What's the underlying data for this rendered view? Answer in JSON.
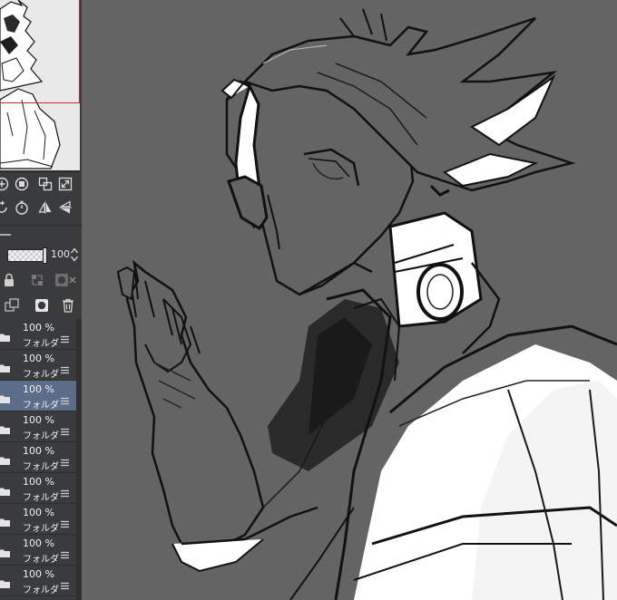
{
  "colors": {
    "panel_bg": "#3a3b3d",
    "canvas_bg": "#646464",
    "selected_layer": "#5c6d8a",
    "nav_frame": "#c4262e"
  },
  "tools": {
    "row1": [
      "plus-circle-icon",
      "stop-circle-icon",
      "transform-icon",
      "expand-icon"
    ],
    "row2": [
      "rotate-icon",
      "timer-icon",
      "flip-horizontal-icon",
      "flip-vertical-icon"
    ]
  },
  "layer_palette": {
    "opacity_value": "100",
    "icons_row1": [
      "lock-icon",
      "reference-icon",
      "clip-icon"
    ],
    "icons_row2": [
      "copy-icon",
      "mask-icon",
      "trash-icon"
    ]
  },
  "layers": [
    {
      "opacity": "100 %",
      "name": "フォルダ",
      "selected": false
    },
    {
      "opacity": "100 %",
      "name": "フォルダ",
      "selected": false
    },
    {
      "opacity": "100 %",
      "name": "フォルダ",
      "selected": true
    },
    {
      "opacity": "100 %",
      "name": "フォルダ",
      "selected": false
    },
    {
      "opacity": "100 %",
      "name": "フォルダ",
      "selected": false
    },
    {
      "opacity": "100 %",
      "name": "フォルダ",
      "selected": false
    },
    {
      "opacity": "100 %",
      "name": "フォルダ",
      "selected": false
    },
    {
      "opacity": "100 %",
      "name": "フォルダ",
      "selected": false
    },
    {
      "opacity": "100 %",
      "name": "フォルダ",
      "selected": false
    }
  ]
}
